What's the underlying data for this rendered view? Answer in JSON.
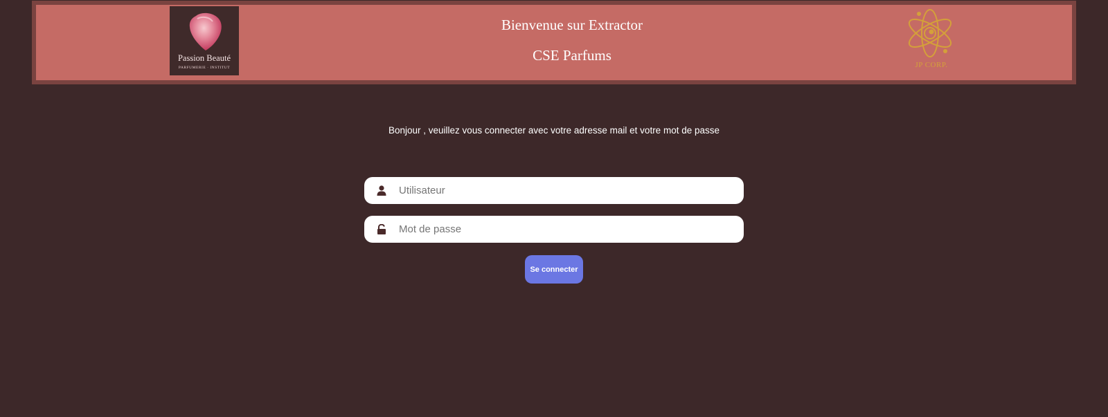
{
  "header": {
    "title": "Bienvenue sur Extractor",
    "subtitle": "CSE Parfums",
    "left_logo": {
      "brand": "Passion Beauté",
      "tagline": "PARFUMERIE · INSTITUT",
      "icon": "petal-logo-icon"
    },
    "right_logo": {
      "text": "JP CORP.",
      "icon": "atom-logo-icon",
      "color": "#d4a03a"
    }
  },
  "login": {
    "intro": "Bonjour , veuillez vous connecter avec votre adresse mail et votre mot de passe",
    "username": {
      "placeholder": "Utilisateur",
      "value": "",
      "icon": "user-icon"
    },
    "password": {
      "placeholder": "Mot de passe",
      "value": "",
      "icon": "unlock-icon"
    },
    "submit_label": "Se connecter"
  },
  "colors": {
    "page_background": "#3d2829",
    "header_background": "#c56b65",
    "header_border": "#7a4340",
    "button": "#6b77e3"
  }
}
